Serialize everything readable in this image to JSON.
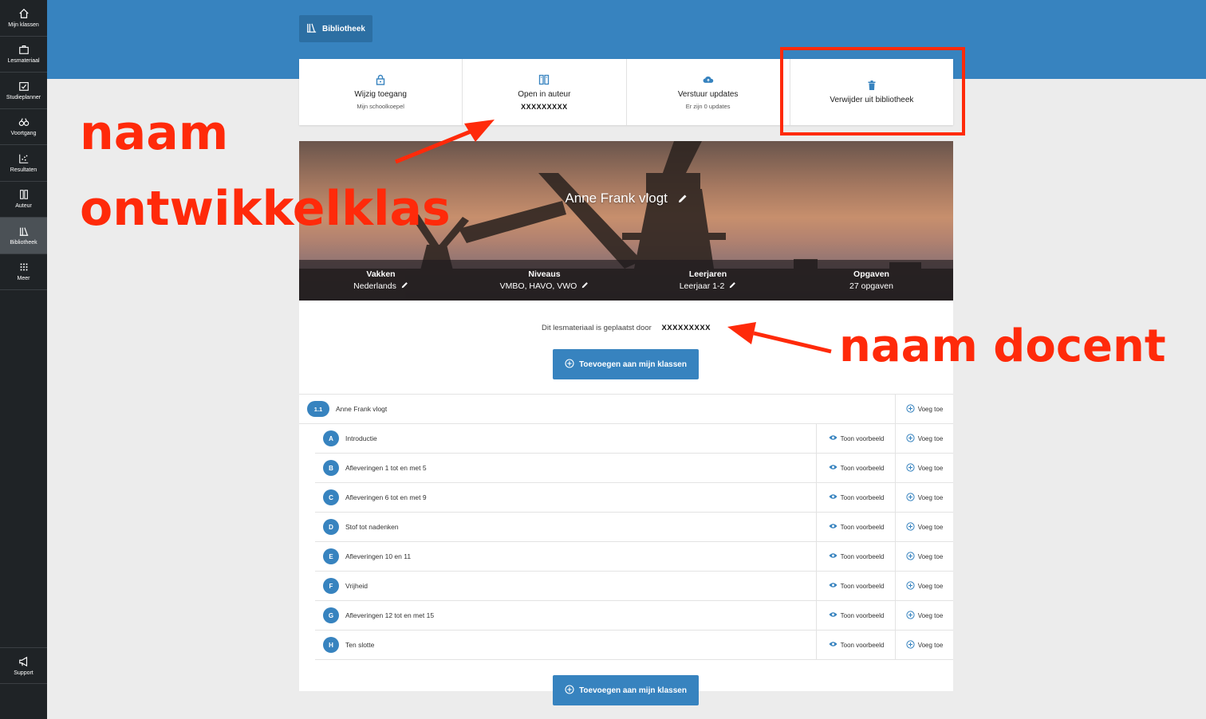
{
  "sidebar": {
    "items": [
      {
        "label": "Mijn klassen",
        "icon": "home-icon"
      },
      {
        "label": "Lesmateriaal",
        "icon": "briefcase-icon"
      },
      {
        "label": "Studieplanner",
        "icon": "calendar-check-icon"
      },
      {
        "label": "Voortgang",
        "icon": "binoculars-icon"
      },
      {
        "label": "Resultaten",
        "icon": "scatter-chart-icon"
      },
      {
        "label": "Auteur",
        "icon": "book-edit-icon"
      },
      {
        "label": "Bibliotheek",
        "icon": "library-icon"
      },
      {
        "label": "Meer",
        "icon": "grid-icon"
      }
    ],
    "support": {
      "label": "Support",
      "icon": "megaphone-icon"
    }
  },
  "header": {
    "breadcrumb": "Bibliotheek"
  },
  "actions": [
    {
      "title": "Wijzig toegang",
      "sub": "Mijn schoolkoepel"
    },
    {
      "title": "Open in auteur",
      "sub": "XXXXXXXXX"
    },
    {
      "title": "Verstuur updates",
      "sub": "Er zijn 0 updates"
    },
    {
      "title": "Verwijder uit bibliotheek"
    }
  ],
  "hero": {
    "title": "Anne Frank vlogt",
    "stats": [
      {
        "label": "Vakken",
        "value": "Nederlands"
      },
      {
        "label": "Niveaus",
        "value": "VMBO, HAVO, VWO"
      },
      {
        "label": "Leerjaren",
        "value": "Leerjaar 1-2"
      },
      {
        "label": "Opgaven",
        "value": "27 opgaven"
      }
    ]
  },
  "panel": {
    "placed_by": "Dit lesmateriaal is geplaatst door",
    "author": "XXXXXXXXX",
    "add_button": "Toevoegen aan mijn klassen"
  },
  "rows": {
    "preview_label": "Toon voorbeeld",
    "add_label": "Voeg toe",
    "main": {
      "badge": "1.1",
      "title": "Anne Frank vlogt"
    },
    "items": [
      {
        "badge": "A",
        "title": "Introductie"
      },
      {
        "badge": "B",
        "title": "Afleveringen 1 tot en met 5"
      },
      {
        "badge": "C",
        "title": "Afleveringen 6 tot en met 9"
      },
      {
        "badge": "D",
        "title": "Stof tot nadenken"
      },
      {
        "badge": "E",
        "title": "Afleveringen 10 en 11"
      },
      {
        "badge": "F",
        "title": "Vrijheid"
      },
      {
        "badge": "G",
        "title": "Afleveringen 12 tot en met 15"
      },
      {
        "badge": "H",
        "title": "Ten slotte"
      }
    ]
  },
  "annotations": {
    "naam": "naam",
    "ontwikkelklas": "ontwikkelklas",
    "naam_docent": "naam docent",
    "color": "#ff2a0a"
  },
  "colors": {
    "primary": "#3783bf",
    "sidebar": "#1f2326"
  }
}
